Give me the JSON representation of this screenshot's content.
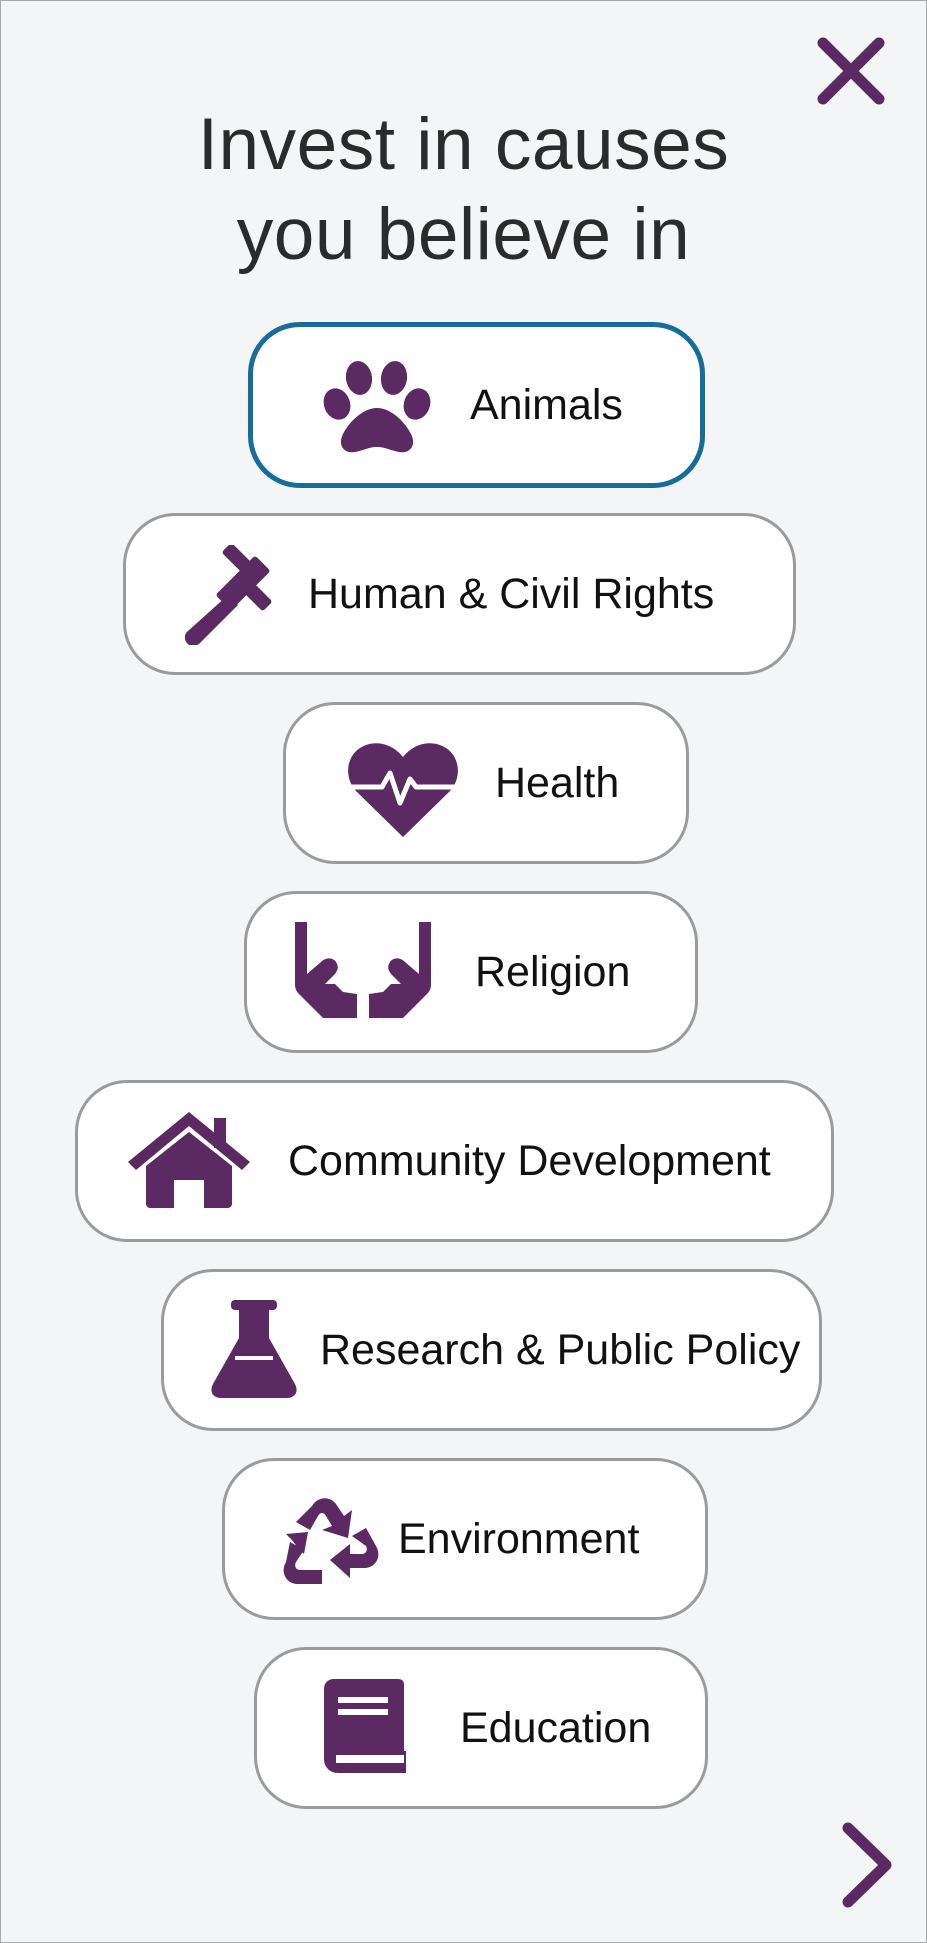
{
  "colors": {
    "accent": "#5c2a62",
    "selected_border": "#166d9b",
    "border": "#9b9b9b",
    "background": "#f3f5f7"
  },
  "header": {
    "title_line1": "Invest in causes",
    "title_line2": "you believe in"
  },
  "controls": {
    "close_icon": "close-icon",
    "next_icon": "chevron-right-icon"
  },
  "causes": [
    {
      "label": "Animals",
      "icon": "paw-icon",
      "selected": true
    },
    {
      "label": "Human & Civil Rights",
      "icon": "gavel-icon",
      "selected": false
    },
    {
      "label": "Health",
      "icon": "heart-pulse-icon",
      "selected": false
    },
    {
      "label": "Religion",
      "icon": "praying-hands-icon",
      "selected": false
    },
    {
      "label": "Community Development",
      "icon": "house-icon",
      "selected": false
    },
    {
      "label": "Research & Public Policy",
      "icon": "flask-icon",
      "selected": false
    },
    {
      "label": "Environment",
      "icon": "recycle-icon",
      "selected": false
    },
    {
      "label": "Education",
      "icon": "book-icon",
      "selected": false
    }
  ]
}
